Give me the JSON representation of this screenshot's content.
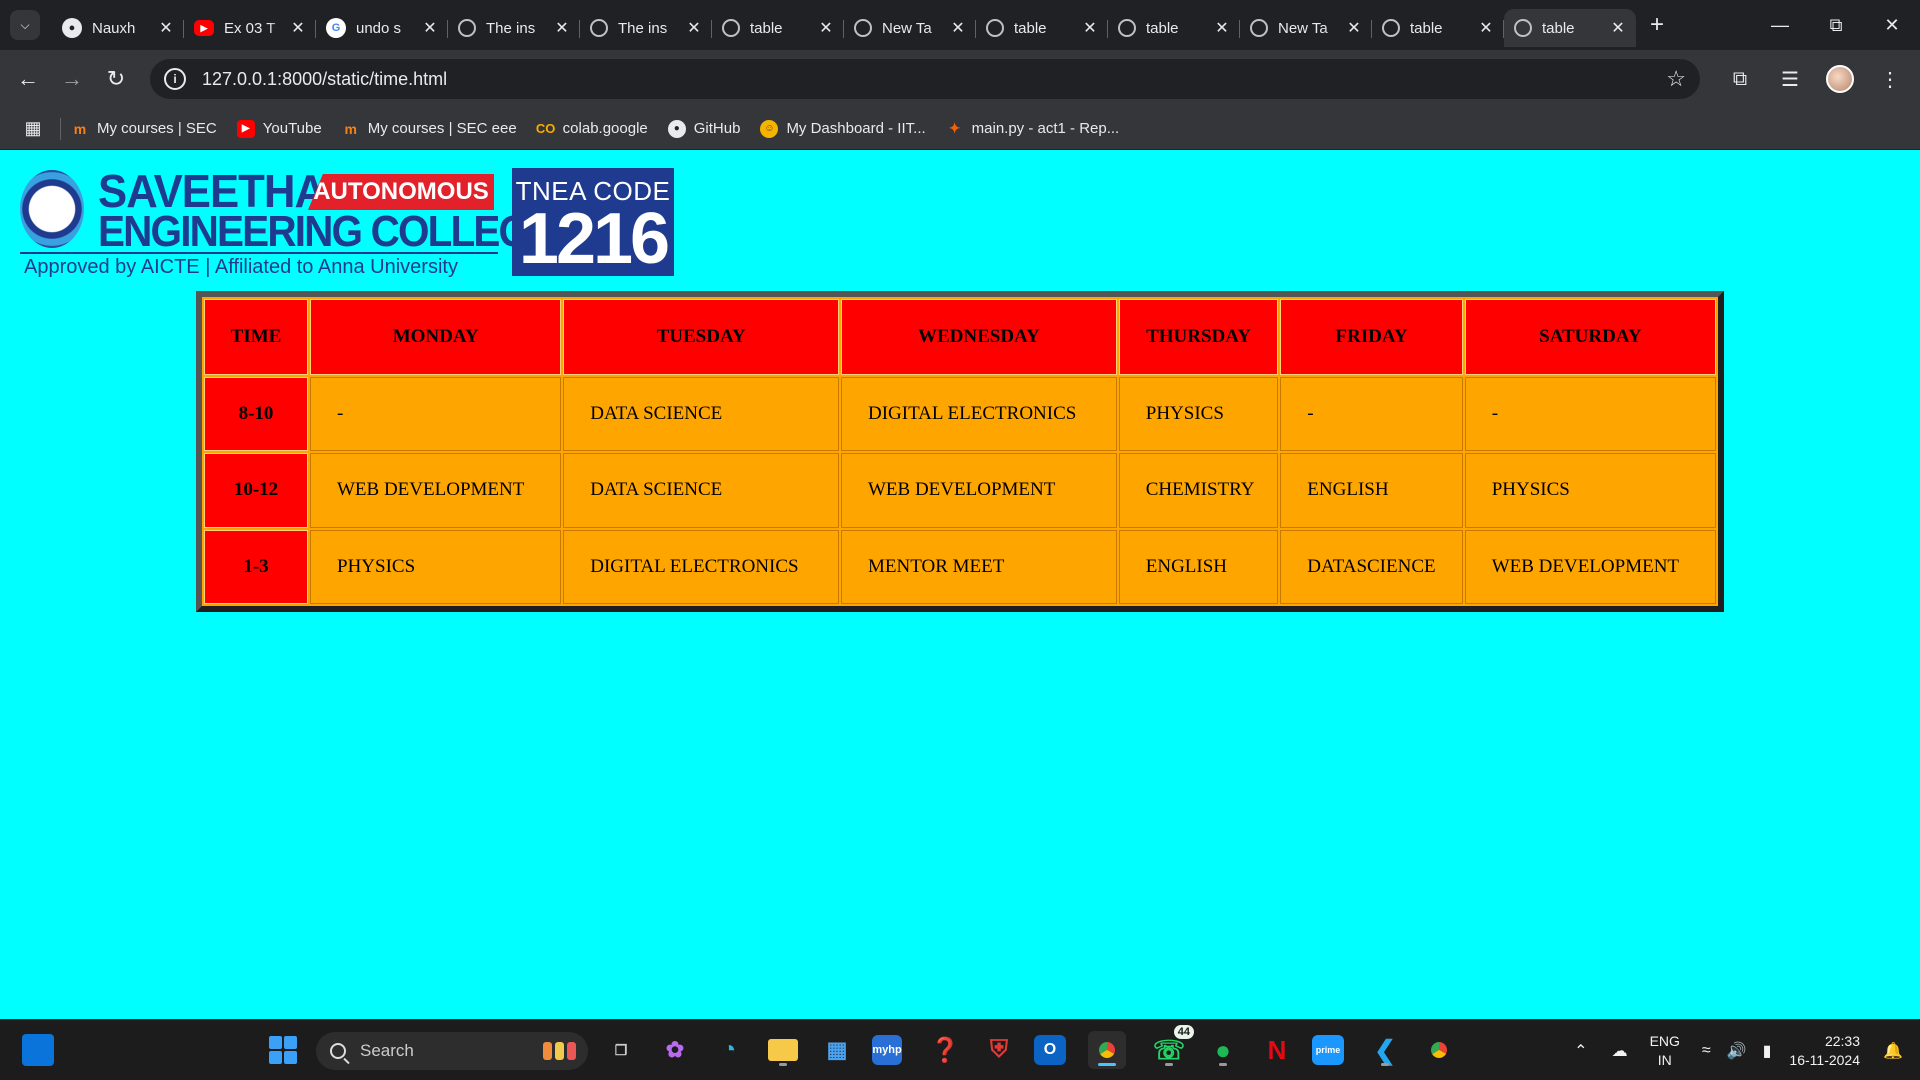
{
  "browser": {
    "tabs": [
      {
        "title": "Nauxh",
        "favicon": "github-icon"
      },
      {
        "title": "Ex 03 T",
        "favicon": "youtube-icon"
      },
      {
        "title": "undo s",
        "favicon": "google-icon"
      },
      {
        "title": "The ins",
        "favicon": "globe-icon"
      },
      {
        "title": "The ins",
        "favicon": "globe-icon"
      },
      {
        "title": "table",
        "favicon": "globe-icon"
      },
      {
        "title": "New Ta",
        "favicon": "chrome-icon"
      },
      {
        "title": "table",
        "favicon": "globe-icon"
      },
      {
        "title": "table",
        "favicon": "globe-icon"
      },
      {
        "title": "New Ta",
        "favicon": "chrome-icon"
      },
      {
        "title": "table",
        "favicon": "globe-icon"
      },
      {
        "title": "table",
        "favicon": "globe-icon",
        "active": true
      }
    ],
    "new_tab_label": "+",
    "url": "127.0.0.1:8000/static/time.html",
    "bookmarks": [
      {
        "label": "My courses | SEC",
        "icon": "moodle-icon"
      },
      {
        "label": "YouTube",
        "icon": "youtube-icon"
      },
      {
        "label": "My courses | SEC eee",
        "icon": "moodle-icon"
      },
      {
        "label": "colab.google",
        "icon": "colab-icon"
      },
      {
        "label": "GitHub",
        "icon": "github-icon"
      },
      {
        "label": "My Dashboard - IIT...",
        "icon": "iit-icon"
      },
      {
        "label": "main.py - act1 - Rep...",
        "icon": "replit-icon"
      }
    ]
  },
  "logo": {
    "name_line1": "SAVEETHA",
    "name_line2": "ENGINEERING COLLEGE",
    "autonomous": "AUTONOMOUS",
    "tagline": "Approved by AICTE  |  Affiliated to Anna University",
    "tnea_label": "TNEA CODE",
    "tnea_code": "1216"
  },
  "timetable": {
    "headers": [
      "TIME",
      "MONDAY",
      "TUESDAY",
      "WEDNESDAY",
      "THURSDAY",
      "FRIDAY",
      "SATURDAY"
    ],
    "rows": [
      {
        "time": "8-10",
        "cells": [
          "-",
          "DATA SCIENCE",
          "DIGITAL ELECTRONICS",
          "PHYSICS",
          "-",
          "-"
        ]
      },
      {
        "time": "10-12",
        "cells": [
          "WEB DEVELOPMENT",
          "DATA SCIENCE",
          "WEB DEVELOPMENT",
          "CHEMISTRY",
          "ENGLISH",
          "PHYSICS"
        ]
      },
      {
        "time": "1-3",
        "cells": [
          "PHYSICS",
          "DIGITAL ELECTRONICS",
          "MENTOR MEET",
          "ENGLISH",
          "DATASCIENCE",
          "WEB DEVELOPMENT"
        ]
      }
    ],
    "colors": {
      "header_bg": "#ff0000",
      "cell_bg": "#ffa500",
      "page_bg": "#00ffff"
    }
  },
  "taskbar": {
    "search_label": "Search",
    "whatsapp_badge": "44",
    "lang_line1": "ENG",
    "lang_line2": "IN",
    "time": "22:33",
    "date": "16-11-2024"
  }
}
